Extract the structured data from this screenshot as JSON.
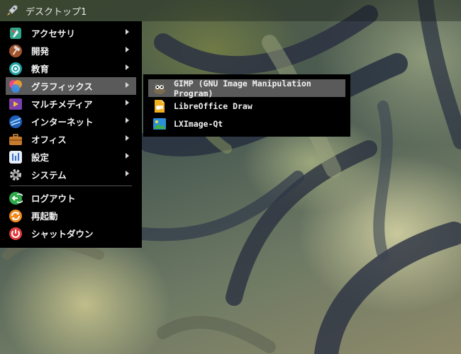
{
  "panel": {
    "desktop_title": "デスクトップ1",
    "launcher_icon": "rocket-icon"
  },
  "menu": {
    "items": [
      {
        "label": "アクセサリ",
        "icon": "accessories-icon",
        "has_submenu": true
      },
      {
        "label": "開発",
        "icon": "development-hammer-icon",
        "has_submenu": true
      },
      {
        "label": "教育",
        "icon": "education-icon",
        "has_submenu": true
      },
      {
        "label": "グラフィックス",
        "icon": "graphics-icon",
        "has_submenu": true,
        "selected": true
      },
      {
        "label": "マルチメディア",
        "icon": "multimedia-icon",
        "has_submenu": true
      },
      {
        "label": "インターネット",
        "icon": "internet-globe-icon",
        "has_submenu": true
      },
      {
        "label": "オフィス",
        "icon": "office-briefcase-icon",
        "has_submenu": true
      },
      {
        "label": "設定",
        "icon": "settings-icon",
        "has_submenu": true
      },
      {
        "label": "システム",
        "icon": "system-gear-icon",
        "has_submenu": true
      }
    ],
    "actions": [
      {
        "label": "ログアウト",
        "icon": "logout-icon"
      },
      {
        "label": "再起動",
        "icon": "reboot-icon"
      },
      {
        "label": "シャットダウン",
        "icon": "shutdown-icon"
      }
    ]
  },
  "submenu": {
    "items": [
      {
        "label": "GIMP (GNU Image Manipulation Program)",
        "icon": "gimp-icon",
        "selected": true
      },
      {
        "label": "LibreOffice Draw",
        "icon": "libreoffice-draw-icon"
      },
      {
        "label": "LXImage-Qt",
        "icon": "lximage-qt-icon"
      }
    ]
  },
  "colors": {
    "menu_bg": "#000000",
    "highlight_bg": "#5a5a5a"
  }
}
